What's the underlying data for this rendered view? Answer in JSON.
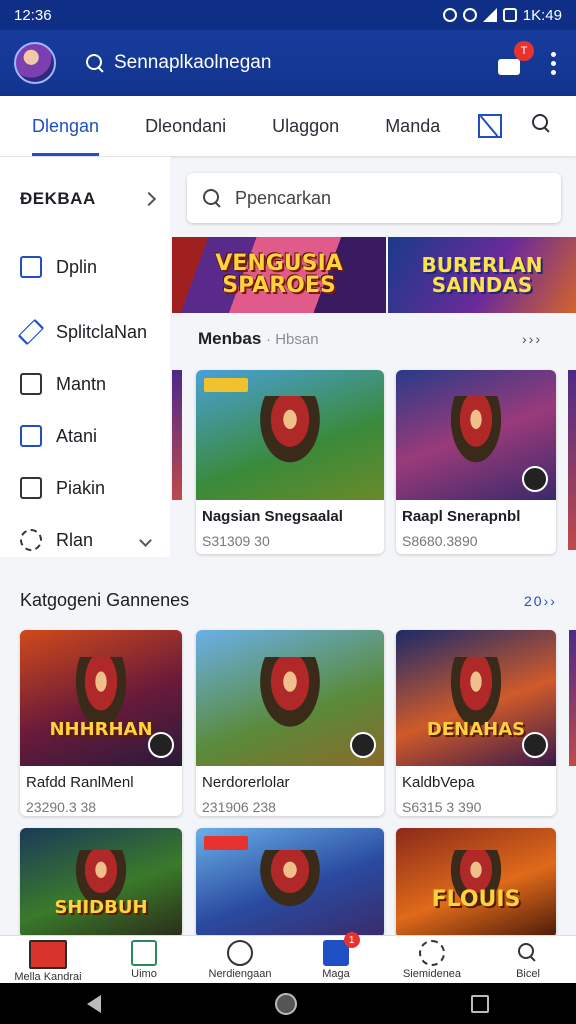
{
  "status_bar": {
    "time": "12:36",
    "right_time": "1K:49"
  },
  "app_bar": {
    "search_text": "Sennaplkaolnegan",
    "cart_badge": "T"
  },
  "tabs": [
    {
      "label": "Dlengan",
      "active": true
    },
    {
      "label": "Dleondani",
      "active": false
    },
    {
      "label": "Ulaggon",
      "active": false
    },
    {
      "label": "Manda",
      "active": false
    }
  ],
  "sidebar": {
    "header": "ÐEKBAA",
    "items": [
      {
        "label": "Dplin",
        "icon": "square-icon"
      },
      {
        "label": "SplitclaNan",
        "icon": "pencil-icon"
      },
      {
        "label": "Mantn",
        "icon": "clipboard-icon"
      },
      {
        "label": "Atani",
        "icon": "document-icon"
      },
      {
        "label": "Piakin",
        "icon": "download-icon"
      },
      {
        "label": "Rlan",
        "icon": "gear-icon"
      }
    ]
  },
  "search": {
    "placeholder": "Ppencarkan"
  },
  "banners": [
    {
      "title": "VENGUSIA\nSPAROES"
    },
    {
      "title": "BURERLAN\nSAINDAS"
    }
  ],
  "section1": {
    "title": "Menbas",
    "subtitle": "Hbsan",
    "more": "›››",
    "cards": [
      {
        "name": "Nagsian Snegsaalal",
        "price": "S31309 30"
      },
      {
        "name": "Raapl Snerapnbl",
        "price": "S8680.3890"
      }
    ]
  },
  "section2": {
    "title": "Katgogeni Gannenes",
    "more": "20››",
    "cards": [
      {
        "name": "Rafdd RanlMenl",
        "price": "23290.3 38",
        "art_title": "NHHRHAN"
      },
      {
        "name": "Nerdorerlolar",
        "price": "231906 238",
        "art_title": ""
      },
      {
        "name": "KaldbVepa",
        "price": "S6315 3 390",
        "art_title": "DENAHAS"
      },
      {
        "name": "",
        "price": "",
        "art_title": "SHIDBUH"
      },
      {
        "name": "",
        "price": "",
        "art_title": ""
      },
      {
        "name": "",
        "price": "",
        "art_title": "FLOUIS"
      }
    ]
  },
  "bottom_nav": [
    {
      "label": "Mella Kandrai",
      "icon": "close-box-icon"
    },
    {
      "label": "Uimo",
      "icon": "chart-icon"
    },
    {
      "label": "Nerdiengaan",
      "icon": "compass-icon"
    },
    {
      "label": "Maga",
      "icon": "home-icon",
      "badge": "1"
    },
    {
      "label": "Siemidenea",
      "icon": "settings-icon"
    },
    {
      "label": "Bicel",
      "icon": "search-icon"
    }
  ]
}
